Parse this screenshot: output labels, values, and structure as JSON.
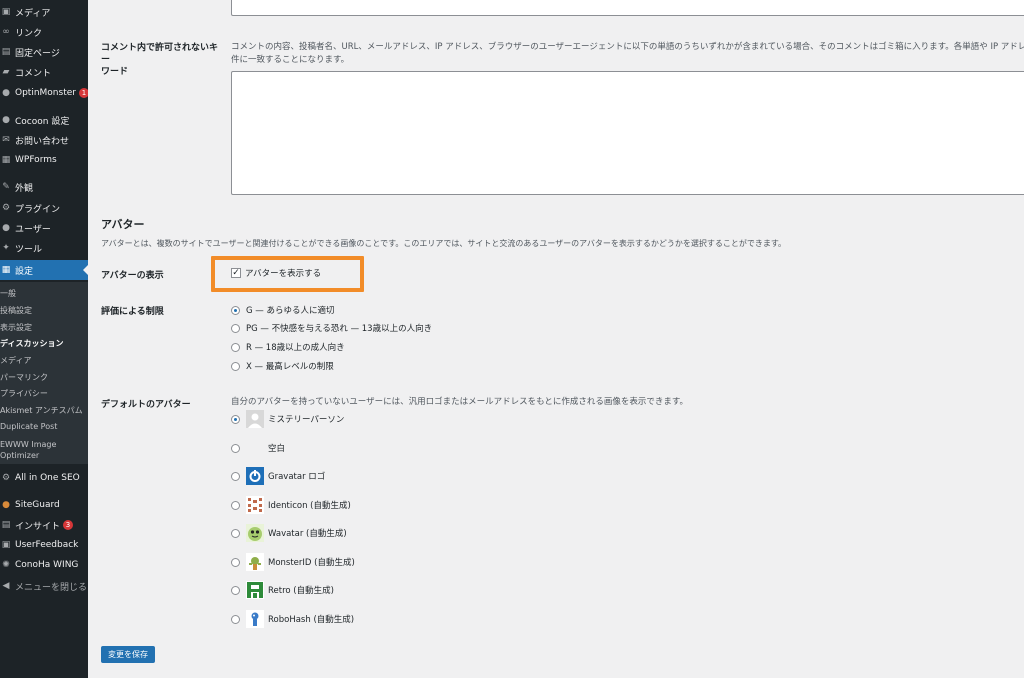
{
  "sidebar": {
    "items": [
      {
        "label": "メディア",
        "icon": "media-icon"
      },
      {
        "label": "リンク",
        "icon": "link-icon"
      },
      {
        "label": "固定ページ",
        "icon": "page-icon"
      },
      {
        "label": "コメント",
        "icon": "comment-icon"
      },
      {
        "label": "OptinMonster",
        "icon": "optinmonster-icon",
        "badge": "1"
      },
      {
        "label": "Cocoon 設定",
        "icon": "cocoon-icon"
      },
      {
        "label": "お問い合わせ",
        "icon": "mail-icon"
      },
      {
        "label": "WPForms",
        "icon": "wpforms-icon"
      },
      {
        "label": "外観",
        "icon": "appearance-icon"
      },
      {
        "label": "プラグイン",
        "icon": "plugin-icon"
      },
      {
        "label": "ユーザー",
        "icon": "user-icon"
      },
      {
        "label": "ツール",
        "icon": "tool-icon"
      },
      {
        "label": "設定",
        "icon": "settings-icon",
        "active": true
      }
    ],
    "submenu": [
      "一般",
      "投稿設定",
      "表示設定",
      "ディスカッション",
      "メディア",
      "パーマリンク",
      "プライバシー",
      "Akismet アンチスパム",
      "Duplicate Post",
      "EWWW Image",
      "Optimizer"
    ],
    "bottom_items": [
      {
        "label": "All in One SEO",
        "icon": "aioseo-icon"
      },
      {
        "label": "SiteGuard",
        "icon": "siteguard-icon"
      },
      {
        "label": "インサイト",
        "icon": "insights-icon",
        "badge": "3"
      },
      {
        "label": "UserFeedback",
        "icon": "userfeedback-icon"
      },
      {
        "label": "ConoHa WING",
        "icon": "conoha-icon"
      },
      {
        "label": "メニューを閉じる",
        "icon": "collapse-icon"
      }
    ]
  },
  "main": {
    "disallowed_keys": {
      "label_line1": "コメント内で許可されないキー",
      "label_line2": "ワード",
      "desc_line1": "コメントの内容、投稿者名、URL、メールアドレス、IP アドレス、ブラウザーのユーザーエージェントに以下の単語のうちいずれかが含まれている場合、そのコメントはゴミ箱に入ります。各単語や IP アドレスは",
      "desc_line2": "件に一致することになります。"
    },
    "avatar_section": {
      "title": "アバター",
      "description": "アバターとは、複数のサイトでユーザーと関連付けることができる画像のことです。このエリアでは、サイトと交流のあるユーザーのアバターを表示するかどうかを選択することができます。"
    },
    "show_avatars": {
      "label": "アバターの表示",
      "checkbox_label": "アバターを表示する",
      "checked": true
    },
    "rating": {
      "label": "評価による制限",
      "options": [
        "G — あらゆる人に適切",
        "PG — 不快感を与える恐れ — 13歳以上の人向き",
        "R — 18歳以上の成人向き",
        "X — 最高レベルの制限"
      ],
      "selected": 0
    },
    "default_avatar": {
      "label": "デフォルトのアバター",
      "description": "自分のアバターを持っていないユーザーには、汎用ロゴまたはメールアドレスをもとに作成される画像を表示できます。",
      "options": [
        "ミステリーパーソン",
        "空白",
        "Gravatar ロゴ",
        "Identicon (自動生成)",
        "Wavatar (自動生成)",
        "MonsterID (自動生成)",
        "Retro (自動生成)",
        "RoboHash (自動生成)"
      ],
      "selected": 0
    },
    "save_button": "変更を保存"
  },
  "colors": {
    "sidebar_bg": "#1d2327",
    "accent": "#2271b1",
    "highlight": "#f28c28",
    "badge": "#d63638"
  }
}
